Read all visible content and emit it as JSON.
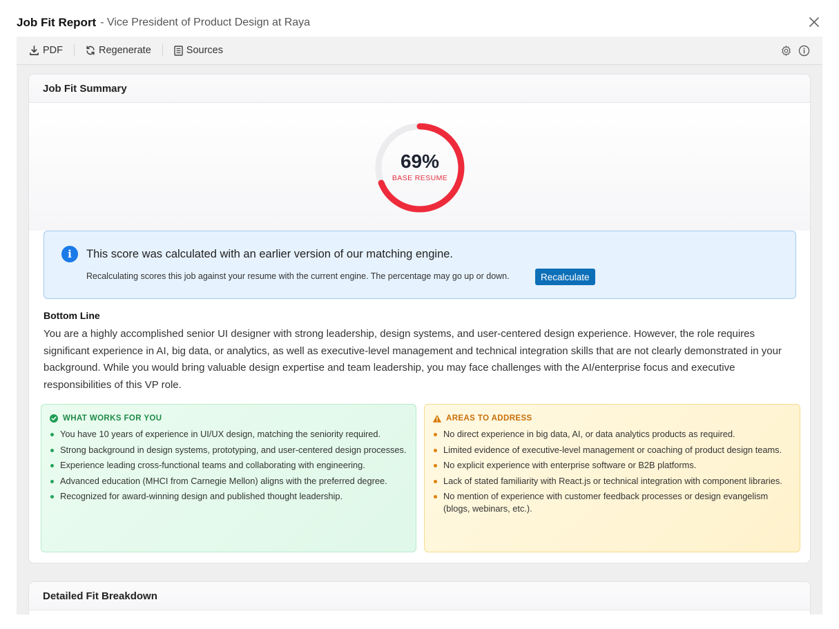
{
  "header": {
    "title": "Job Fit Report",
    "subtitle": "- Vice President of Product Design at Raya"
  },
  "toolbar": {
    "pdf_label": "PDF",
    "regenerate_label": "Regenerate",
    "sources_label": "Sources"
  },
  "summary": {
    "heading": "Job Fit Summary",
    "score_percent": 69,
    "score_text": "69%",
    "score_label": "BASE RESUME",
    "gauge_color": "#ee2b3b",
    "gauge_track_color": "#ececee"
  },
  "alert": {
    "title": "This score was calculated with an earlier version of our matching engine.",
    "text": "Recalculating scores this job against your resume with the current engine. The percentage may go up or down.",
    "button_label": "Recalculate"
  },
  "bottom_line": {
    "heading": "Bottom Line",
    "text": "You are a highly accomplished senior UI designer with strong leadership, design systems, and user-centered design experience. However, the role requires significant experience in AI, big data, or analytics, as well as executive-level management and technical integration skills that are not clearly demonstrated in your background. While you would bring valuable design expertise and team leadership, you may face challenges with the AI/enterprise focus and executive responsibilities of this VP role."
  },
  "strengths": {
    "heading": "WHAT WORKS FOR YOU",
    "items": [
      "You have 10 years of experience in UI/UX design, matching the seniority required.",
      "Strong background in design systems, prototyping, and user-centered design processes.",
      "Experience leading cross-functional teams and collaborating with engineering.",
      "Advanced education (MHCI from Carnegie Mellon) aligns with the preferred degree.",
      "Recognized for award-winning design and published thought leadership."
    ]
  },
  "gaps": {
    "heading": "AREAS TO ADDRESS",
    "items": [
      "No direct experience in big data, AI, or data analytics products as required.",
      "Limited evidence of executive-level management or coaching of product design teams.",
      "No explicit experience with enterprise software or B2B platforms.",
      "Lack of stated familiarity with React.js or technical integration with component libraries.",
      "No mention of experience with customer feedback processes or design evangelism (blogs, webinars, etc.)."
    ]
  },
  "detail": {
    "heading": "Detailed Fit Breakdown"
  },
  "icons": {
    "close": "close-icon",
    "pdf": "download-icon",
    "regenerate": "refresh-icon",
    "sources": "document-icon",
    "settings": "gear-icon",
    "info": "info-icon",
    "alert": "info-circle-icon",
    "strengths": "check-circle-icon",
    "gaps": "warning-icon"
  }
}
